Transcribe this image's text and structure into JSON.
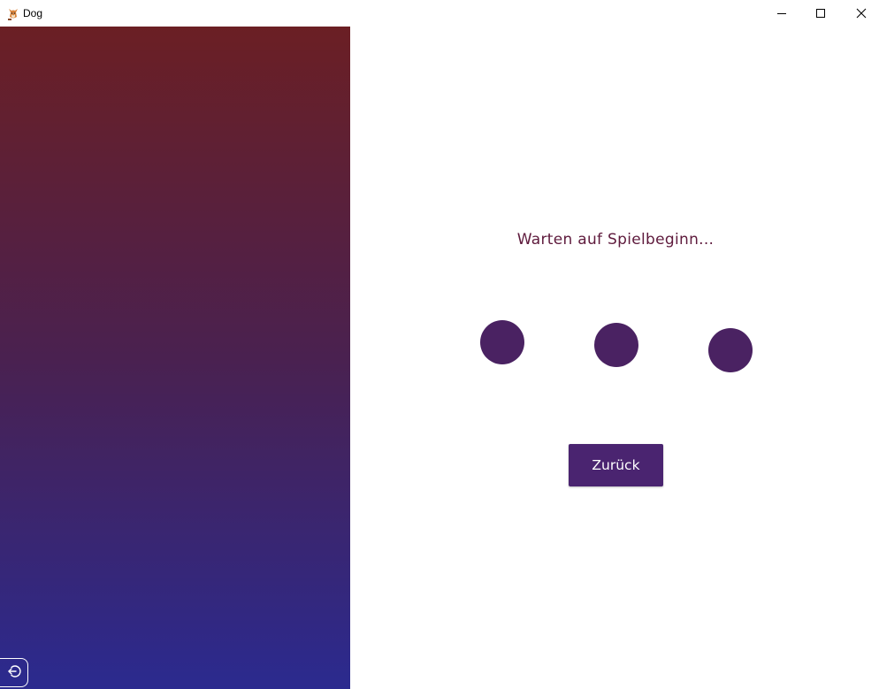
{
  "window": {
    "title": "Dog",
    "icon": "dog-app-icon"
  },
  "controls": {
    "minimize_icon": "minimize-icon",
    "maximize_icon": "maximize-icon",
    "close_icon": "close-icon"
  },
  "side_panel": {
    "gradient_top": "#6b1f24",
    "gradient_bottom": "#2b2a8f",
    "logout_icon": "logout-icon"
  },
  "main": {
    "status_text": "Warten auf Spielbeginn...",
    "status_color": "#5e1a3c",
    "dot_color": "#4a2262",
    "back_button_label": "Zurück",
    "back_button_color": "#4a2470"
  }
}
